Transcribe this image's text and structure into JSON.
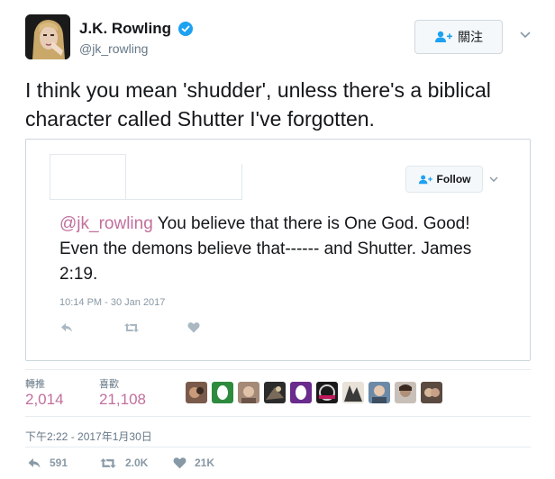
{
  "author": {
    "display_name": "J.K. Rowling",
    "handle": "@jk_rowling",
    "verified": true
  },
  "follow_button": {
    "label": "關注",
    "icon": "add-user-icon"
  },
  "tweet": {
    "text": "I think you mean 'shudder', unless there's a biblical character called Shutter I've forgotten."
  },
  "quoted_tweet": {
    "follow_label": "Follow",
    "mention": "@jk_rowling",
    "text": " You believe that there is One God. Good! Even the demons believe that------ and Shutter. James 2:19.",
    "timestamp": "10:14 PM - 30 Jan 2017"
  },
  "stats": {
    "retweets_label": "轉推",
    "retweets_value": "2,014",
    "likes_label": "喜歡",
    "likes_value": "21,108"
  },
  "timestamp": "下午2:22 - 2017年1月30日",
  "actions": {
    "reply_count": "591",
    "retweet_count": "2.0K",
    "like_count": "21K"
  },
  "colors": {
    "link": "#c26f9d",
    "verified": "#1da1f2",
    "muted": "#8899a6",
    "border": "#ccd6dd"
  }
}
